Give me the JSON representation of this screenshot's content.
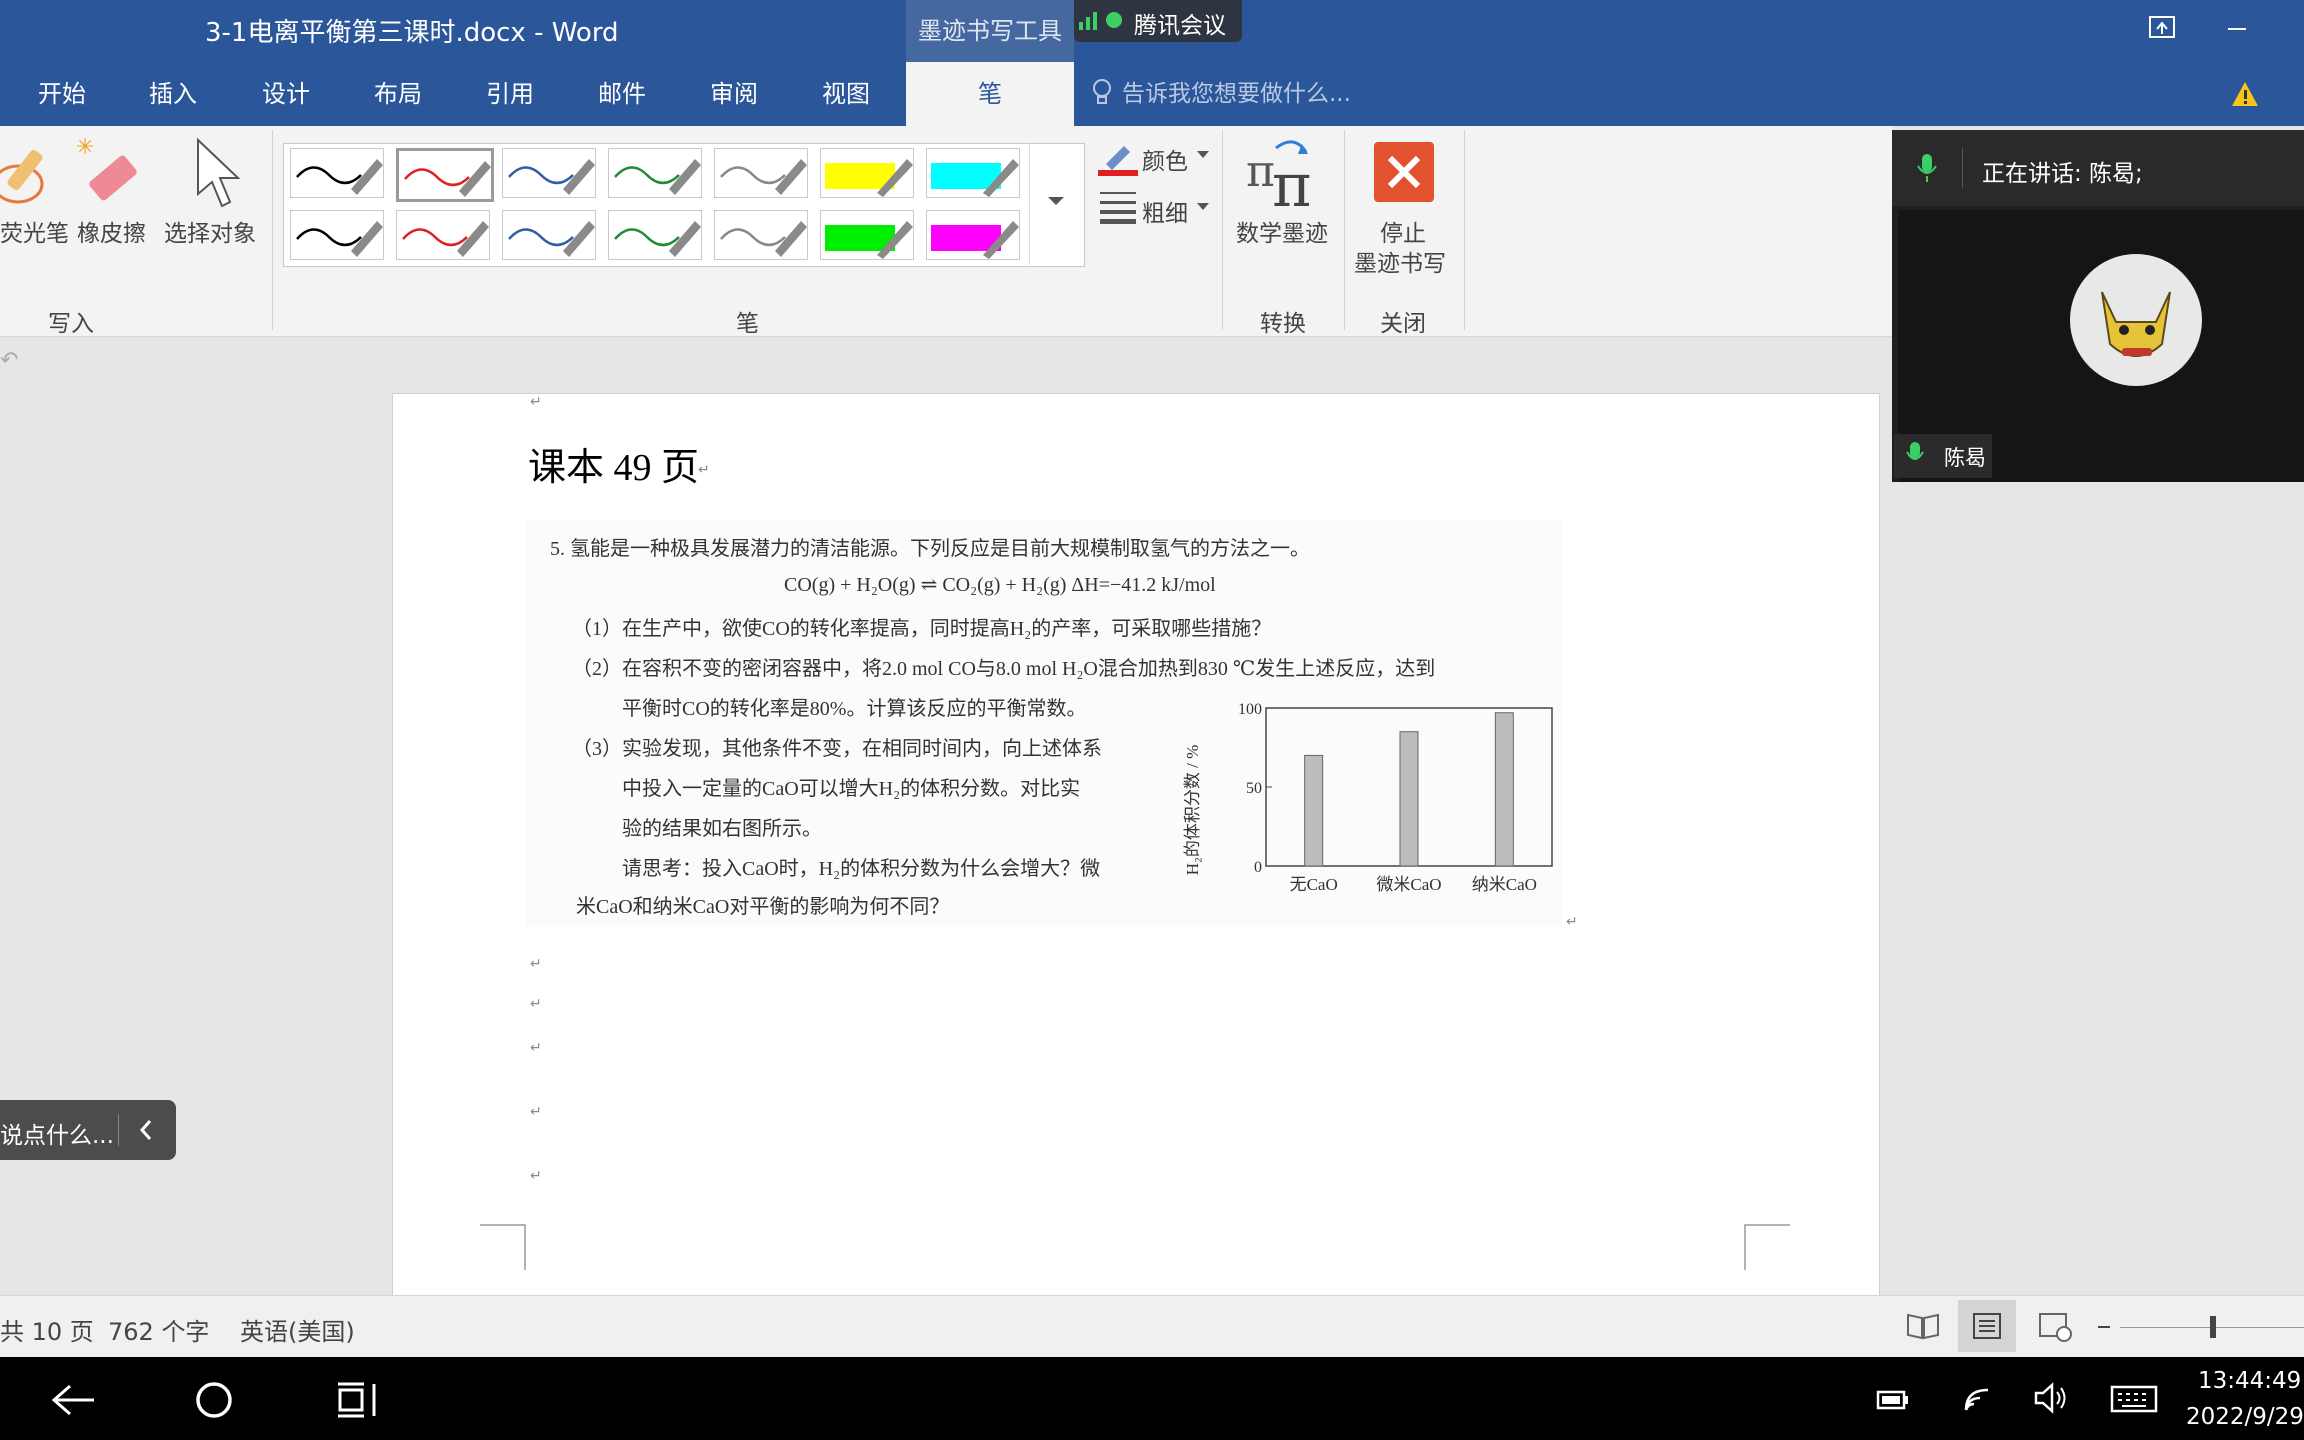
{
  "window": {
    "title": "3-1电离平衡第三课时.docx - Word"
  },
  "contextual_tab": {
    "label": "墨迹书写工具"
  },
  "meeting": {
    "name": "腾讯会议"
  },
  "menu": {
    "tabs": [
      "开始",
      "插入",
      "设计",
      "布局",
      "引用",
      "邮件",
      "审阅",
      "视图"
    ],
    "active_tab": "笔",
    "tellme_placeholder": "告诉我您想要做什么..."
  },
  "ribbon": {
    "write": {
      "highlighter": "荧光笔",
      "eraser": "橡皮擦",
      "select": "选择对象",
      "group": "写入"
    },
    "pens": {
      "group": "笔",
      "color_label": "颜色",
      "thickness_label": "粗细",
      "pen_colors_row1": [
        "#000000",
        "#e02020",
        "#2f5fa8",
        "#1f8a3a",
        "#888888",
        "#ffff00",
        "#00ffff"
      ],
      "pen_colors_row2": [
        "#000000",
        "#e02020",
        "#2f5fa8",
        "#1f8a3a",
        "#888888",
        "#00ee00",
        "#ff00ff"
      ]
    },
    "convert": {
      "math_ink": "数学墨迹",
      "group": "转换"
    },
    "close": {
      "stop_line1": "停止",
      "stop_line2": "墨迹书写",
      "group": "关闭"
    }
  },
  "video": {
    "speaking_label": "正在讲话: 陈曷;",
    "participant_name": "陈曷"
  },
  "chat": {
    "placeholder": "说点什么..."
  },
  "document": {
    "heading": "课本 49 页",
    "question": {
      "intro": "5. 氢能是一种极具发展潜力的清洁能源。下列反应是目前大规模制取氢气的方法之一。",
      "equation": "CO(g) + H₂O(g) ⇌ CO₂(g) + H₂(g)     ΔH=−41.2 kJ/mol",
      "q1": "（1）在生产中，欲使CO的转化率提高，同时提高H₂的产率，可采取哪些措施？",
      "q2a": "（2）在容积不变的密闭容器中，将2.0 mol CO与8.0 mol H₂O混合加热到830 ℃发生上述反应，达到",
      "q2b": "平衡时CO的转化率是80%。计算该反应的平衡常数。",
      "q3a": "（3）实验发现，其他条件不变，在相同时间内，向上述体系",
      "q3b": "中投入一定量的CaO可以增大H₂的体积分数。对比实",
      "q3c": "验的结果如右图所示。",
      "q3d": "请思考：投入CaO时，H₂的体积分数为什么会增大？微",
      "q3e": "米CaO和纳米CaO对平衡的影响为何不同？"
    }
  },
  "chart_data": {
    "type": "bar",
    "categories": [
      "无CaO",
      "微米CaO",
      "纳米CaO"
    ],
    "values": [
      70,
      85,
      97
    ],
    "ylabel": "H₂的体积分数 / %",
    "yticks": [
      "0",
      "50",
      "100"
    ],
    "ylim": [
      0,
      100
    ]
  },
  "status": {
    "pages": "共 10 页",
    "words": "762 个字",
    "language": "英语(美国)"
  },
  "clock": {
    "time": "13:44:49",
    "date": "2022/9/29"
  }
}
